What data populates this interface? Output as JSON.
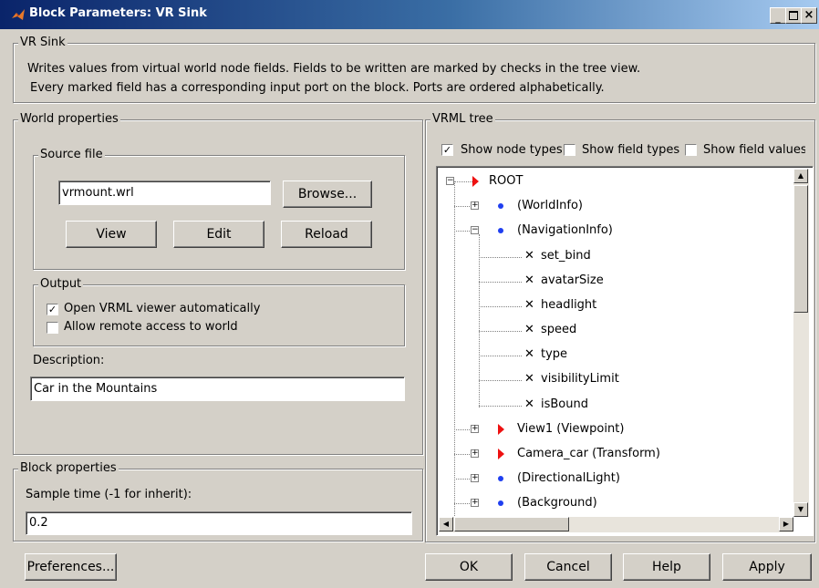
{
  "window": {
    "title": "Block Parameters: VR Sink",
    "caption_buttons": [
      "_",
      "□",
      "×"
    ]
  },
  "header": {
    "group_label": "VR Sink",
    "desc_line1": "Writes values from virtual world node fields. Fields to be written are marked by checks in the tree view.",
    "desc_line2": "Every marked field has a corresponding input port on the block. Ports are ordered alphabetically."
  },
  "world": {
    "group_label": "World properties",
    "source": {
      "group_label": "Source file",
      "file_value": "vrmount.wrl",
      "browse_label": "Browse...",
      "view_label": "View",
      "edit_label": "Edit",
      "reload_label": "Reload"
    },
    "output": {
      "group_label": "Output",
      "open_viewer_label": "Open VRML viewer automatically",
      "open_viewer_checked": true,
      "remote_access_label": "Allow remote access to world",
      "remote_access_checked": false
    },
    "description_label": "Description:",
    "description_value": "Car in the Mountains"
  },
  "block": {
    "group_label": "Block properties",
    "sample_time_label": "Sample time (-1 for inherit):",
    "sample_time_value": "0.2"
  },
  "vrml": {
    "group_label": "VRML tree",
    "show_node_types_label": "Show node types",
    "show_node_types_checked": true,
    "show_field_types_label": "Show field types",
    "show_field_types_checked": false,
    "show_field_values_label": "Show field values",
    "show_field_values_checked": false,
    "tree": [
      {
        "label": "ROOT",
        "marker": "triangle",
        "expander": "minus"
      },
      {
        "label": "(WorldInfo)",
        "marker": "dot",
        "expander": "plus"
      },
      {
        "label": "(NavigationInfo)",
        "marker": "dot",
        "expander": "minus"
      },
      {
        "label": "set_bind",
        "marker": "x"
      },
      {
        "label": "avatarSize",
        "marker": "x"
      },
      {
        "label": "headlight",
        "marker": "x"
      },
      {
        "label": "speed",
        "marker": "x"
      },
      {
        "label": "type",
        "marker": "x"
      },
      {
        "label": "visibilityLimit",
        "marker": "x"
      },
      {
        "label": "isBound",
        "marker": "x"
      },
      {
        "label": "View1 (Viewpoint)",
        "marker": "triangle",
        "expander": "plus"
      },
      {
        "label": "Camera_car (Transform)",
        "marker": "triangle",
        "expander": "plus"
      },
      {
        "label": "(DirectionalLight)",
        "marker": "dot",
        "expander": "plus"
      },
      {
        "label": "(Background)",
        "marker": "dot",
        "expander": "plus"
      }
    ]
  },
  "footer": {
    "preferences_label": "Preferences...",
    "ok_label": "OK",
    "cancel_label": "Cancel",
    "help_label": "Help",
    "apply_label": "Apply"
  },
  "colors": {
    "titlebar_start": "#0a246a",
    "titlebar_end": "#a6caf0",
    "node_marker": "#ee1111",
    "field_marker": "#1f3ff0"
  }
}
